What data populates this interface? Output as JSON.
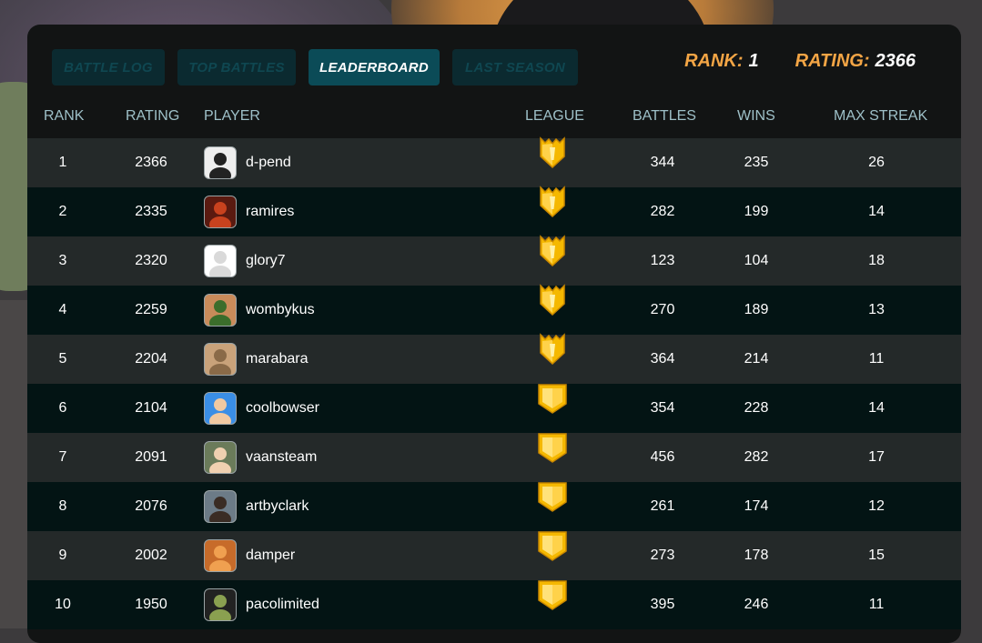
{
  "tabs": [
    {
      "label": "BATTLE LOG",
      "active": false
    },
    {
      "label": "TOP BATTLES",
      "active": false
    },
    {
      "label": "LEADERBOARD",
      "active": true
    },
    {
      "label": "LAST SEASON",
      "active": false
    }
  ],
  "stats": {
    "rank_label": "RANK:",
    "rank_value": "1",
    "rating_label": "RATING:",
    "rating_value": "2366"
  },
  "columns": {
    "rank": "RANK",
    "rating": "RATING",
    "player": "PLAYER",
    "league": "LEAGUE",
    "battles": "BATTLES",
    "wins": "WINS",
    "max_streak": "MAX STREAK"
  },
  "colors": {
    "accent_orange": "#f3a545",
    "active_tab": "#0b4b57",
    "inactive_tab": "#0b2a30",
    "header_text": "#9ec0c8",
    "league_gold": "#f5b800"
  },
  "rows": [
    {
      "rank": "1",
      "rating": "2366",
      "player": "d-pend",
      "league_icon": "champion-crest-icon",
      "battles": "344",
      "wins": "235",
      "max_streak": "26"
    },
    {
      "rank": "2",
      "rating": "2335",
      "player": "ramires",
      "league_icon": "champion-crest-icon",
      "battles": "282",
      "wins": "199",
      "max_streak": "14"
    },
    {
      "rank": "3",
      "rating": "2320",
      "player": "glory7",
      "league_icon": "champion-crest-icon",
      "battles": "123",
      "wins": "104",
      "max_streak": "18"
    },
    {
      "rank": "4",
      "rating": "2259",
      "player": "wombykus",
      "league_icon": "champion-crest-icon",
      "battles": "270",
      "wins": "189",
      "max_streak": "13"
    },
    {
      "rank": "5",
      "rating": "2204",
      "player": "marabara",
      "league_icon": "champion-crest-icon",
      "battles": "364",
      "wins": "214",
      "max_streak": "11"
    },
    {
      "rank": "6",
      "rating": "2104",
      "player": "coolbowser",
      "league_icon": "gold-shield-icon",
      "battles": "354",
      "wins": "228",
      "max_streak": "14"
    },
    {
      "rank": "7",
      "rating": "2091",
      "player": "vaansteam",
      "league_icon": "gold-shield-icon",
      "battles": "456",
      "wins": "282",
      "max_streak": "17"
    },
    {
      "rank": "8",
      "rating": "2076",
      "player": "artbyclark",
      "league_icon": "gold-shield-icon",
      "battles": "261",
      "wins": "174",
      "max_streak": "12"
    },
    {
      "rank": "9",
      "rating": "2002",
      "player": "damper",
      "league_icon": "gold-shield-icon",
      "battles": "273",
      "wins": "178",
      "max_streak": "15"
    },
    {
      "rank": "10",
      "rating": "1950",
      "player": "pacolimited",
      "league_icon": "gold-shield-icon",
      "battles": "395",
      "wins": "246",
      "max_streak": "11"
    }
  ]
}
